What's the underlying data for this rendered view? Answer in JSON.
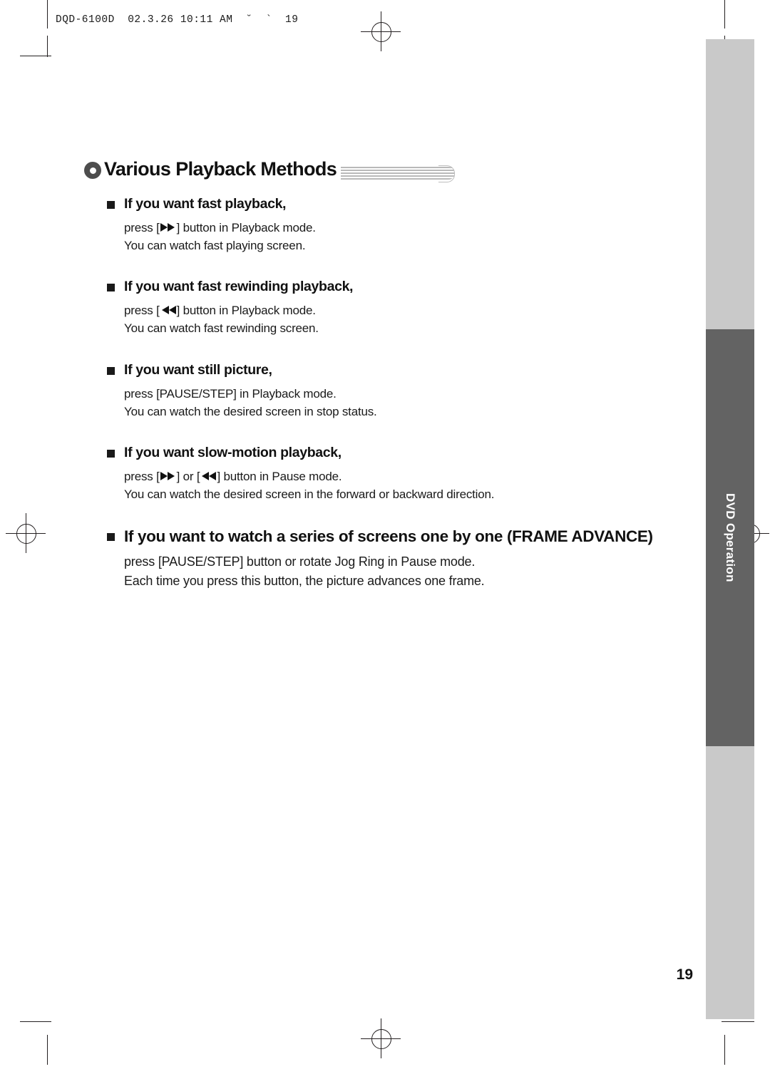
{
  "print_code": "DQD-6100D  02.3.26 10:11 AM  ˘  `  19",
  "title": {
    "text": "Various Playback Methods",
    "bullet_icon": "circle-bullet-icon"
  },
  "side_tab": {
    "label": "DVD Operation",
    "color": "#636363",
    "band_color": "#c9c9c9"
  },
  "sections": [
    {
      "heading": "If you want fast playback,",
      "lines": [
        "press [ ▶▶ ] button in Playback mode.",
        "You can watch fast playing screen."
      ]
    },
    {
      "heading": "If you want fast rewinding playback,",
      "lines": [
        "press [ ◀◀ ] button in Playback mode.",
        "You can watch fast rewinding screen."
      ]
    },
    {
      "heading": "If you want still picture,",
      "lines": [
        "press [PAUSE/STEP] in Playback mode.",
        "You can watch the desired screen in stop status."
      ]
    },
    {
      "heading": "If you want slow-motion playback,",
      "lines": [
        "press [ ▶▶ ] or [ ◀◀ ] button in Pause mode.",
        "You can watch the desired screen in the forward or backward direction."
      ]
    },
    {
      "heading": "If you want to watch a series of screens one by one (FRAME ADVANCE)",
      "lines": [
        "press [PAUSE/STEP] button or rotate Jog Ring in Pause mode.",
        "Each time you press this button, the picture advances one frame."
      ]
    }
  ],
  "page_number": "19"
}
